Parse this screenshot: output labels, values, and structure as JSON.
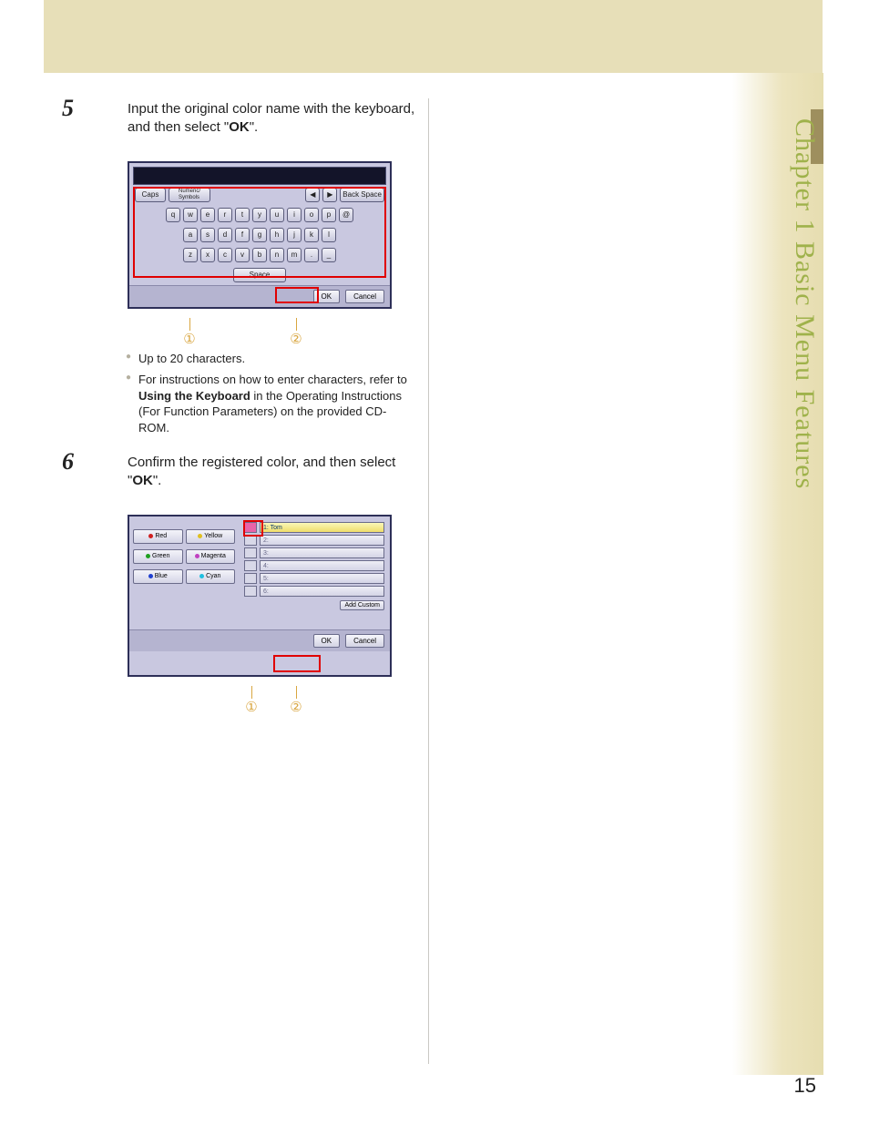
{
  "chapter_label": "Chapter 1   Basic Menu Features",
  "page_number": "15",
  "steps": [
    {
      "num": "5",
      "text_pre": "Input the original color name with the keyboard, and then select \"",
      "text_bold": "OK",
      "text_post": "\"."
    },
    {
      "num": "6",
      "text_pre": "Confirm the registered color, and then select \"",
      "text_bold": "OK",
      "text_post": "\"."
    }
  ],
  "bullets": [
    "Up to 20 characters.",
    "For instructions on how to enter characters, refer to Using the Keyboard in the Operating Instructions (For Function Parameters) on the provided CD-ROM."
  ],
  "bullet2_bold": "Using the Keyboard",
  "keyboard": {
    "toolbar": [
      "Caps",
      "Numeric/\nSymbols",
      "◀",
      "▶",
      "Back Space"
    ],
    "rows": [
      [
        "q",
        "w",
        "e",
        "r",
        "t",
        "y",
        "u",
        "i",
        "o",
        "p",
        "@"
      ],
      [
        "a",
        "s",
        "d",
        "f",
        "g",
        "h",
        "j",
        "k",
        "l"
      ],
      [
        "z",
        "x",
        "c",
        "v",
        "b",
        "n",
        "m",
        ".",
        "_"
      ]
    ],
    "space": "Space",
    "ok": "OK",
    "cancel": "Cancel"
  },
  "callouts_kb": [
    "①",
    "②"
  ],
  "color_panel": {
    "colors": [
      {
        "name": "Red",
        "hex": "#d02020"
      },
      {
        "name": "Yellow",
        "hex": "#e0c020"
      },
      {
        "name": "Green",
        "hex": "#20a020"
      },
      {
        "name": "Magenta",
        "hex": "#c040c0"
      },
      {
        "name": "Blue",
        "hex": "#2040d0"
      },
      {
        "name": "Cyan",
        "hex": "#20c0e0"
      }
    ],
    "slots": [
      {
        "label": "1: Tom",
        "sw": "#e863a8",
        "filled": true
      },
      {
        "label": "2:",
        "filled": false
      },
      {
        "label": "3:",
        "filled": false
      },
      {
        "label": "4:",
        "filled": false
      },
      {
        "label": "5:",
        "filled": false
      },
      {
        "label": "6:",
        "filled": false
      }
    ],
    "add_custom": "Add Custom",
    "ok": "OK",
    "cancel": "Cancel"
  },
  "callouts_cp": [
    "①",
    "②"
  ]
}
